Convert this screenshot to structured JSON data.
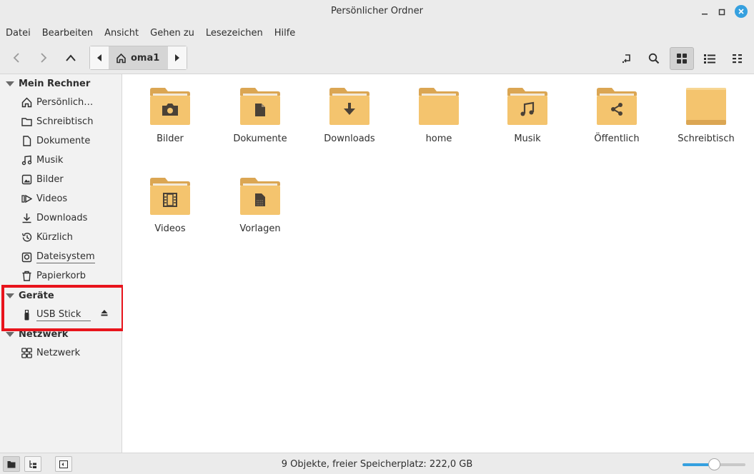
{
  "window": {
    "title": "Persönlicher Ordner"
  },
  "menu": [
    "Datei",
    "Bearbeiten",
    "Ansicht",
    "Gehen zu",
    "Lesezeichen",
    "Hilfe"
  ],
  "path": {
    "current": "oma1"
  },
  "sidebar": {
    "sections": [
      {
        "label": "Mein Rechner"
      },
      {
        "label": "Geräte"
      },
      {
        "label": "Netzwerk"
      }
    ],
    "items": [
      {
        "label": "Persönlich…",
        "icon": "home-icon"
      },
      {
        "label": "Schreibtisch",
        "icon": "folder-icon"
      },
      {
        "label": "Dokumente",
        "icon": "document-icon"
      },
      {
        "label": "Musik",
        "icon": "music-icon"
      },
      {
        "label": "Bilder",
        "icon": "image-icon"
      },
      {
        "label": "Videos",
        "icon": "video-icon"
      },
      {
        "label": "Downloads",
        "icon": "download-icon"
      },
      {
        "label": "Kürzlich",
        "icon": "recent-icon"
      },
      {
        "label": "Dateisystem",
        "icon": "drive-icon"
      },
      {
        "label": "Papierkorb",
        "icon": "trash-icon"
      }
    ],
    "devices": [
      {
        "label": "USB Stick",
        "icon": "usb-icon"
      }
    ],
    "network": [
      {
        "label": "Netzwerk",
        "icon": "network-icon"
      }
    ]
  },
  "folders": [
    {
      "label": "Bilder",
      "emblem": "camera"
    },
    {
      "label": "Dokumente",
      "emblem": "document"
    },
    {
      "label": "Downloads",
      "emblem": "download"
    },
    {
      "label": "home",
      "emblem": "none"
    },
    {
      "label": "Musik",
      "emblem": "music"
    },
    {
      "label": "Öffentlich",
      "emblem": "share"
    },
    {
      "label": "Schreibtisch",
      "emblem": "desktop"
    },
    {
      "label": "Videos",
      "emblem": "film"
    },
    {
      "label": "Vorlagen",
      "emblem": "template"
    }
  ],
  "status": {
    "text": "9 Objekte, freier Speicherplatz: 222,0 GB",
    "zoom_fraction": 0.5
  },
  "colors": {
    "folder": "#f4c46e",
    "folder_dark": "#dba653",
    "emblem": "#4a4136",
    "accent": "#35a0df",
    "highlight": "#e8141c"
  }
}
